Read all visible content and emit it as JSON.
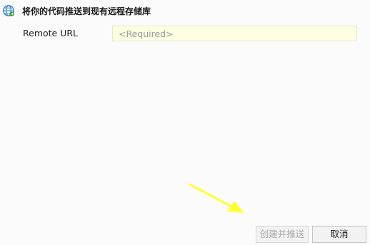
{
  "dialog": {
    "title": "将你的代码推送到现有远程存储库",
    "icon": "globe-icon"
  },
  "form": {
    "remote_url_label": "Remote URL",
    "remote_url_value": "",
    "remote_url_placeholder": "<Required>",
    "input_background": "#fefee2"
  },
  "buttons": {
    "create_and_push_label": "创建并推送",
    "create_and_push_enabled": false,
    "cancel_label": "取消"
  },
  "annotation": {
    "icon": "arrow-icon",
    "color": "#ffff33"
  }
}
